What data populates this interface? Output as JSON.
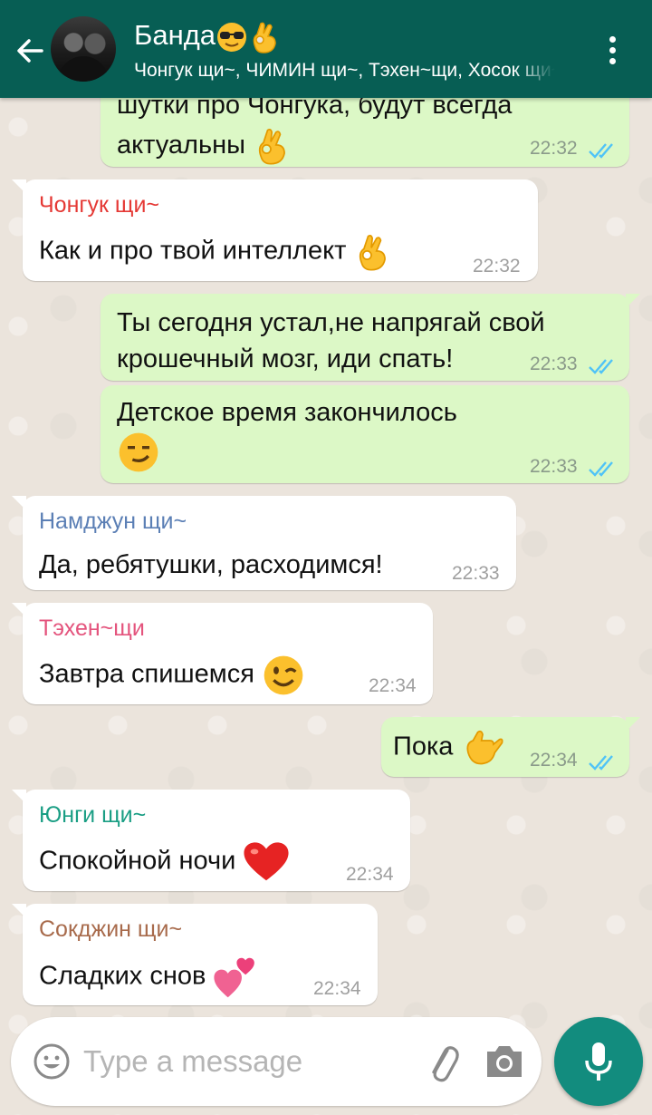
{
  "header": {
    "title": "Банда",
    "subtitle": "Чонгук щи~, ЧИМИН щи~, Тэхен~щи, Хосок щи~, Юнги щи~, Намджун щи~, Сокджин щи~"
  },
  "colors": {
    "header": "#075e54",
    "outgoing": "#dcf8c6",
    "incoming": "#ffffff",
    "read_ticks": "#4fc3f7",
    "accent": "#128c7e"
  },
  "messages": [
    {
      "dir": "out",
      "text_line1": "шутки про Чонгука, будут всегда",
      "text_line2": "актуальны",
      "time": "22:32",
      "status": "read"
    },
    {
      "dir": "in",
      "sender": "Чонгук щи~",
      "sender_color": "#e53935",
      "text": "Как и про твой интеллект",
      "time": "22:32"
    },
    {
      "dir": "out",
      "text_line1": "Ты сегодня устал,не напрягай свой",
      "text_line2": "крошечный мозг, иди спать!",
      "time": "22:33",
      "status": "read"
    },
    {
      "dir": "out",
      "text": "Детское время закончилось",
      "time": "22:33",
      "status": "read"
    },
    {
      "dir": "in",
      "sender": "Намджун щи~",
      "sender_color": "#5b7fb5",
      "text": "Да, ребятушки, расходимся!",
      "time": "22:33"
    },
    {
      "dir": "in",
      "sender": "Тэхен~щи",
      "sender_color": "#e4547d",
      "text": "Завтра спишемся",
      "time": "22:34"
    },
    {
      "dir": "out",
      "text": "Пока",
      "time": "22:34",
      "status": "read"
    },
    {
      "dir": "in",
      "sender": "Юнги щи~",
      "sender_color": "#1a9e84",
      "text": "Спокойной ночи",
      "time": "22:34"
    },
    {
      "dir": "in",
      "sender": "Сокджин щи~",
      "sender_color": "#a86b4c",
      "text": "Сладких снов",
      "time": "22:34"
    }
  ],
  "composer": {
    "placeholder": "Type a message"
  },
  "icons": [
    "back-arrow-icon",
    "avatar",
    "menu-dots-icon",
    "emoji-icon",
    "attach-icon",
    "camera-icon",
    "mic-icon",
    "double-check-icon"
  ]
}
